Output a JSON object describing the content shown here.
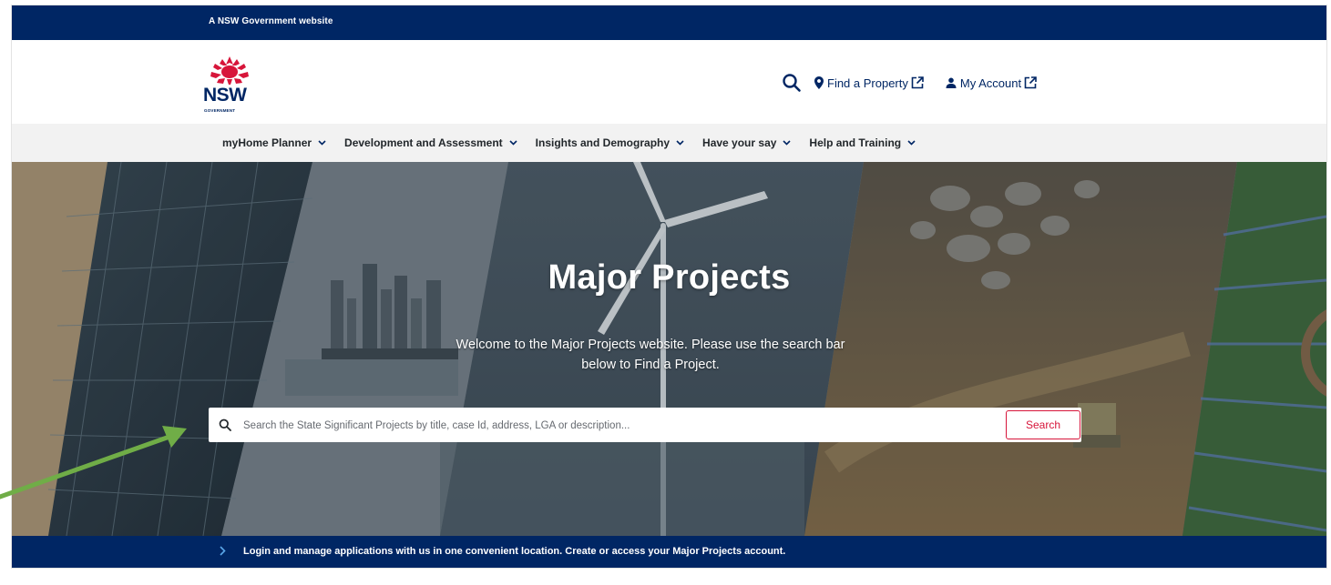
{
  "masthead": {
    "text": "A NSW Government website"
  },
  "logo": {
    "word": "NSW",
    "sub": "GOVERNMENT"
  },
  "header": {
    "search_icon": "search-icon",
    "links": [
      {
        "label": "Find a Property",
        "icon": "location-pin-icon",
        "trailing_icon": "external-link-icon"
      },
      {
        "label": "My Account",
        "icon": "person-icon",
        "trailing_icon": "external-link-icon"
      }
    ]
  },
  "nav": {
    "items": [
      {
        "label": "myHome Planner"
      },
      {
        "label": "Development and Assessment"
      },
      {
        "label": "Insights and Demography"
      },
      {
        "label": "Have your say"
      },
      {
        "label": "Help and Training"
      }
    ]
  },
  "hero": {
    "title": "Major Projects",
    "subtitle": "Welcome to the Major Projects website. Please use the search bar below to Find a Project.",
    "search": {
      "placeholder": "Search the State Significant Projects by title, case Id, address, LGA or description...",
      "value": "",
      "button_label": "Search"
    }
  },
  "banner": {
    "text": "Login and manage applications with us in one convenient location. Create or access your Major Projects account."
  },
  "colors": {
    "navy": "#002664",
    "brand_red": "#d7153a",
    "nav_bg": "#f2f2f2",
    "annotation_green": "#70ad47"
  }
}
